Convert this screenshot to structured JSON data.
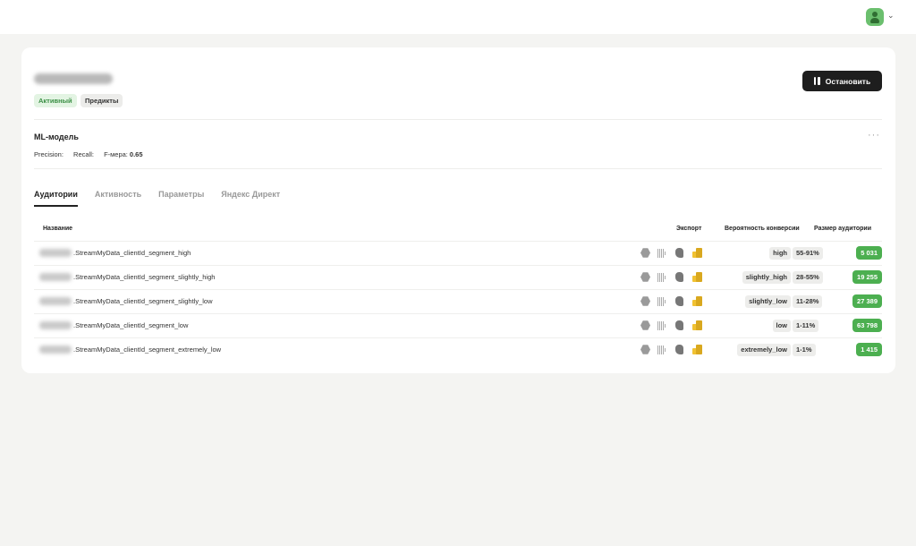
{
  "header": {
    "avatar_icon": "user-avatar-icon",
    "menu_chevron": "⌄"
  },
  "campaign": {
    "badges": {
      "active": "Активный",
      "predicts": "Предикты"
    },
    "stop_button": "Остановить"
  },
  "model": {
    "title": "ML-модель",
    "more": "···",
    "precision_label": "Precision:",
    "recall_label": "Recall:",
    "fmeasure_label": "F-мера:",
    "fmeasure_value": "0.65"
  },
  "tabs": [
    {
      "label": "Аудитории",
      "active": true
    },
    {
      "label": "Активность",
      "active": false
    },
    {
      "label": "Параметры",
      "active": false
    },
    {
      "label": "Яндекс Директ",
      "active": false
    }
  ],
  "table": {
    "headers": {
      "name": "Название",
      "export": "Экспорт",
      "probability": "Вероятность конверсии",
      "size": "Размер аудитории"
    },
    "rows": [
      {
        "name": ".StreamMyData_clientId_segment_high",
        "segment": "high",
        "range": "55-91%",
        "size": "5 031"
      },
      {
        "name": ".StreamMyData_clientId_segment_slightly_high",
        "segment": "slightly_high",
        "range": "28-55%",
        "size": "19 255"
      },
      {
        "name": ".StreamMyData_clientId_segment_slightly_low",
        "segment": "slightly_low",
        "range": "11-28%",
        "size": "27 389"
      },
      {
        "name": ".StreamMyData_clientId_segment_low",
        "segment": "low",
        "range": "1-11%",
        "size": "63 798"
      },
      {
        "name": ".StreamMyData_clientId_segment_extremely_low",
        "segment": "extremely_low",
        "range": "1-1%",
        "size": "1 415"
      }
    ],
    "export_icons": [
      "clickhouse-icon",
      "barcode-icon",
      "postgresql-icon",
      "yandex-metrica-icon"
    ]
  },
  "colors": {
    "accent_green": "#4caf50",
    "active_badge_bg": "#e3f4e3",
    "button_dark": "#1e1e1e"
  }
}
